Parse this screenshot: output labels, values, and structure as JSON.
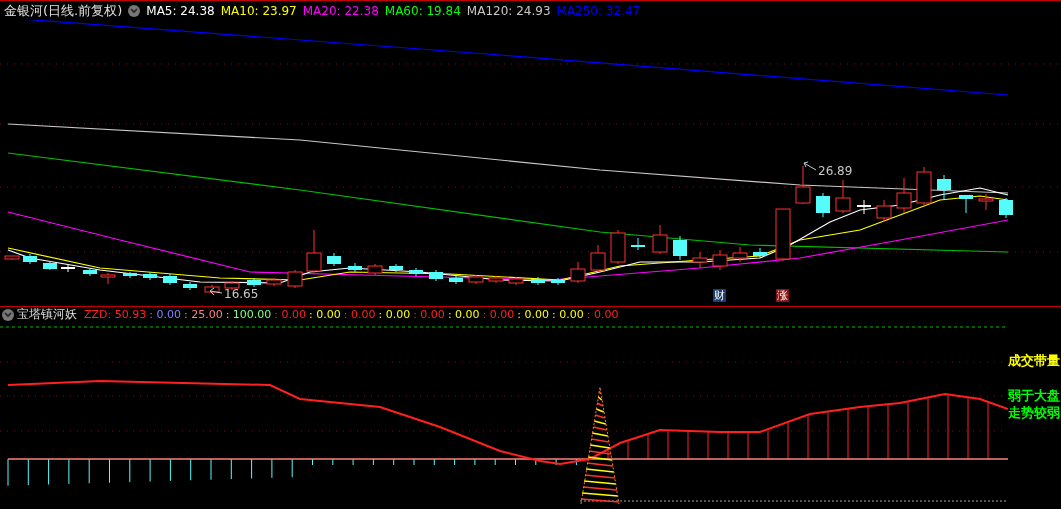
{
  "main_panel": {
    "title": "金银河(日线.前复权)",
    "indicators": [
      {
        "label": "MA5: 24.38",
        "color": "#ffffff"
      },
      {
        "label": "MA10: 23.97",
        "color": "#ffff00"
      },
      {
        "label": "MA20: 22.38",
        "color": "#ff00ff"
      },
      {
        "label": "MA60: 19.84",
        "color": "#00ff00"
      },
      {
        "label": "MA120: 24.93",
        "color": "#c8c8c8"
      },
      {
        "label": "MA250: 32.47",
        "color": "#0000ff"
      }
    ],
    "high_label": "26.89",
    "low_label": "16.65",
    "markers": [
      {
        "text": "财",
        "color": "#1a3c6e"
      },
      {
        "text": "涨",
        "color": "#8a1212"
      }
    ]
  },
  "sub_panel": {
    "title": "宝塔镇河妖",
    "values": [
      {
        "label": "ZZD: 50.93",
        "color": "#ff2020"
      },
      {
        "label": ": 0.00",
        "color": "#8080ff"
      },
      {
        "label": ": 25.00",
        "color": "#ff8080"
      },
      {
        "label": ": 100.00",
        "color": "#80ff80"
      },
      {
        "label": ": 0.00",
        "color": "#ff2020"
      },
      {
        "label": ": 0.00",
        "color": "#ffff00"
      },
      {
        "label": ": 0.00",
        "color": "#ff2020"
      },
      {
        "label": ": 0.00",
        "color": "#ffff00"
      },
      {
        "label": ": 0.00",
        "color": "#ff2020"
      },
      {
        "label": ": 0.00",
        "color": "#ffff00"
      },
      {
        "label": ": 0.00",
        "color": "#ff2020"
      },
      {
        "label": ": 0.00",
        "color": "#ffff00"
      },
      {
        "label": ": 0.00",
        "color": "#ffff00"
      },
      {
        "label": ": 0.00",
        "color": "#ff2020"
      }
    ],
    "labels": [
      {
        "text": "成交带量",
        "color": "#ffff00"
      },
      {
        "text": "弱于大盘",
        "color": "#00ff00"
      },
      {
        "text": "走势较弱",
        "color": "#00ff00"
      }
    ]
  }
}
